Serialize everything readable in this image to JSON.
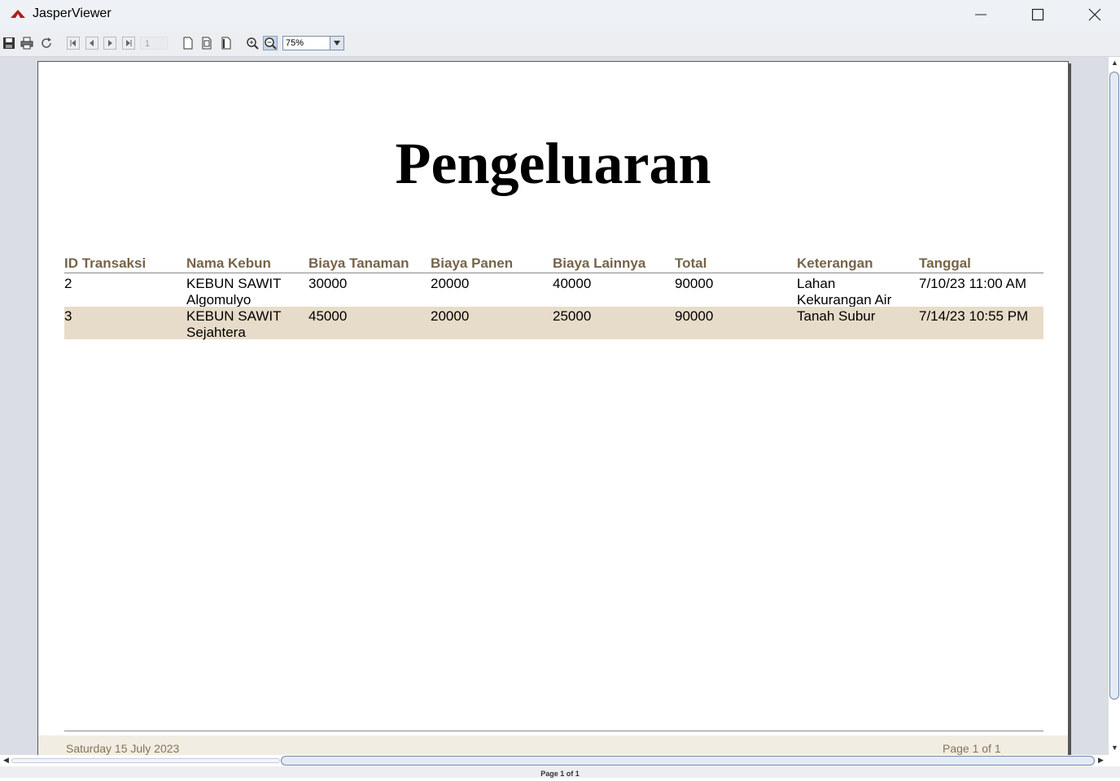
{
  "window": {
    "title": "JasperViewer"
  },
  "toolbar": {
    "page_number": "1",
    "zoom": "75%",
    "buttons": [
      "save-icon",
      "print-icon",
      "reload-icon",
      "first-page-icon",
      "previous-page-icon",
      "next-page-icon",
      "last-page-icon",
      "actual-size-icon",
      "fit-page-icon",
      "fit-width-icon",
      "zoom-in-icon",
      "zoom-out-icon"
    ]
  },
  "report": {
    "title": "Pengeluaran",
    "columns": [
      "ID Transaksi",
      "Nama Kebun",
      "Biaya Tanaman",
      "Biaya Panen",
      "Biaya Lainnya",
      "Total",
      "Keterangan",
      "Tanggal"
    ],
    "rows": [
      {
        "id": "2",
        "nama_kebun_1": "KEBUN SAWIT",
        "nama_kebun_2": "Algomulyo",
        "biaya_tanaman": "30000",
        "biaya_panen": "20000",
        "biaya_lainnya": "40000",
        "total": "90000",
        "keterangan_1": "Lahan",
        "keterangan_2": "Kekurangan Air",
        "tanggal": "7/10/23 11:00 AM"
      },
      {
        "id": "3",
        "nama_kebun_1": "KEBUN SAWIT",
        "nama_kebun_2": "Sejahtera",
        "biaya_tanaman": "45000",
        "biaya_panen": "20000",
        "biaya_lainnya": "25000",
        "total": "90000",
        "keterangan_1": "Tanah Subur",
        "keterangan_2": "",
        "tanggal": "7/14/23 10:55 PM"
      }
    ],
    "footer_date": "Saturday 15 July 2023",
    "footer_page": "Page 1 of 1"
  },
  "status_bar": {
    "text": "Page 1 of 1"
  },
  "colors": {
    "header_text": "#766449",
    "alt_row": "#e7dcc9",
    "footer_band": "#f2ede3",
    "viewer_bg": "#dadde4"
  }
}
